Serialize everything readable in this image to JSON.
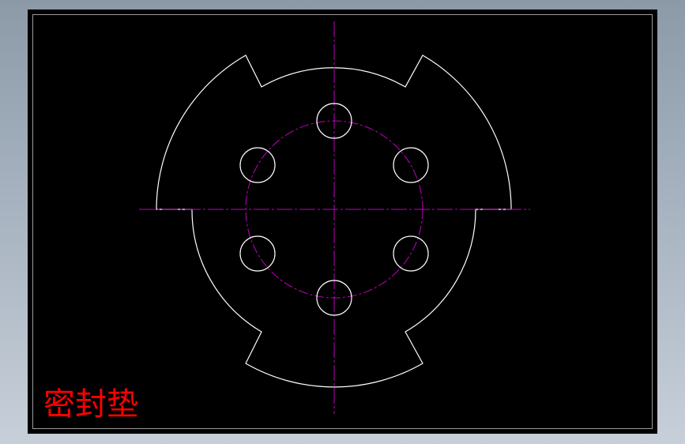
{
  "drawing": {
    "title": "密封垫",
    "colors": {
      "background": "#000000",
      "outline": "#ffffff",
      "centerline": "#c000c0",
      "title": "#ff0000",
      "border": "#9a9a9a"
    },
    "features": {
      "bolt_hole_count": 6,
      "notch_count": 3
    }
  }
}
